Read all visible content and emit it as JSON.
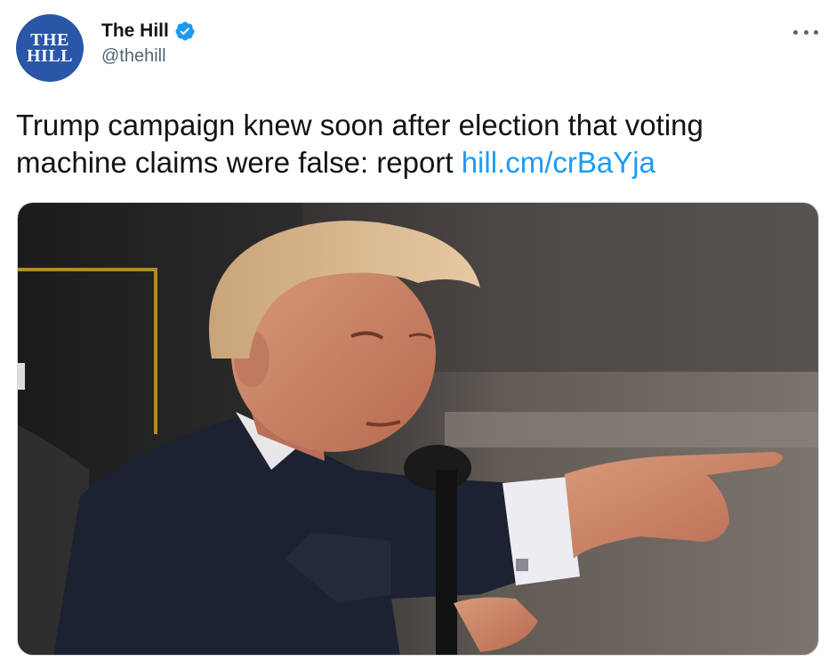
{
  "author": {
    "display_name": "The Hill",
    "handle": "@thehill",
    "verified": true,
    "avatar": {
      "line1": "THE",
      "line2": "HILL",
      "background": "#2a56a8"
    }
  },
  "tweet": {
    "text": "Trump campaign knew soon after election that voting machine claims were false: report",
    "link_text": "hill.cm/crBaYja"
  },
  "icons": {
    "verified": "verified-badge-icon",
    "more": "more-options-icon"
  },
  "colors": {
    "link": "#1d9bf0",
    "verified": "#1d9bf0",
    "text": "#0f1419",
    "secondary": "#536471"
  },
  "media": {
    "type": "photo"
  }
}
